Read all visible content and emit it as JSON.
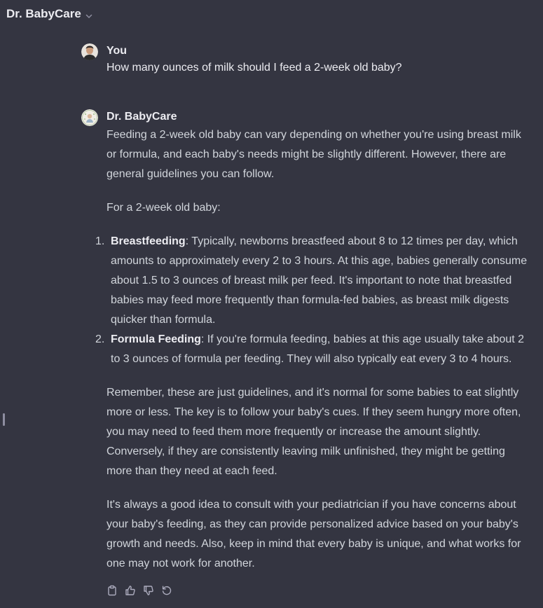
{
  "header": {
    "title": "Dr. BabyCare",
    "icon": "chevron-down-icon"
  },
  "messages": {
    "user": {
      "author": "You",
      "text": "How many ounces of milk should I feed a 2-week old baby?"
    },
    "bot": {
      "author": "Dr. BabyCare",
      "intro": "Feeding a 2-week old baby can vary depending on whether you're using breast milk or formula, and each baby's needs might be slightly different. However, there are general guidelines you can follow.",
      "lead": "For a 2-week old baby:",
      "list": [
        {
          "num": "1.",
          "title": "Breastfeeding",
          "text": ": Typically, newborns breastfeed about 8 to 12 times per day, which amounts to approximately every 2 to 3 hours. At this age, babies generally consume about 1.5 to 3 ounces of breast milk per feed. It's important to note that breastfed babies may feed more frequently than formula-fed babies, as breast milk digests quicker than formula."
        },
        {
          "num": "2.",
          "title": "Formula Feeding",
          "text": ": If you're formula feeding, babies at this age usually take about 2 to 3 ounces of formula per feeding. They will also typically eat every 3 to 4 hours."
        }
      ],
      "reminder": "Remember, these are just guidelines, and it's normal for some babies to eat slightly more or less. The key is to follow your baby's cues. If they seem hungry more often, you may need to feed them more frequently or increase the amount slightly. Conversely, if they are consistently leaving milk unfinished, they might be getting more than they need at each feed.",
      "closing": "It's always a good idea to consult with your pediatrician if you have concerns about your baby's feeding, as they can provide personalized advice based on your baby's growth and needs. Also, keep in mind that every baby is unique, and what works for one may not work for another."
    }
  },
  "actions": [
    "copy-icon",
    "thumbs-up-icon",
    "thumbs-down-icon",
    "regenerate-icon"
  ],
  "colors": {
    "background": "#343541",
    "text": "#d1d5db",
    "heading": "#ececf1",
    "icon": "#acacbe"
  }
}
